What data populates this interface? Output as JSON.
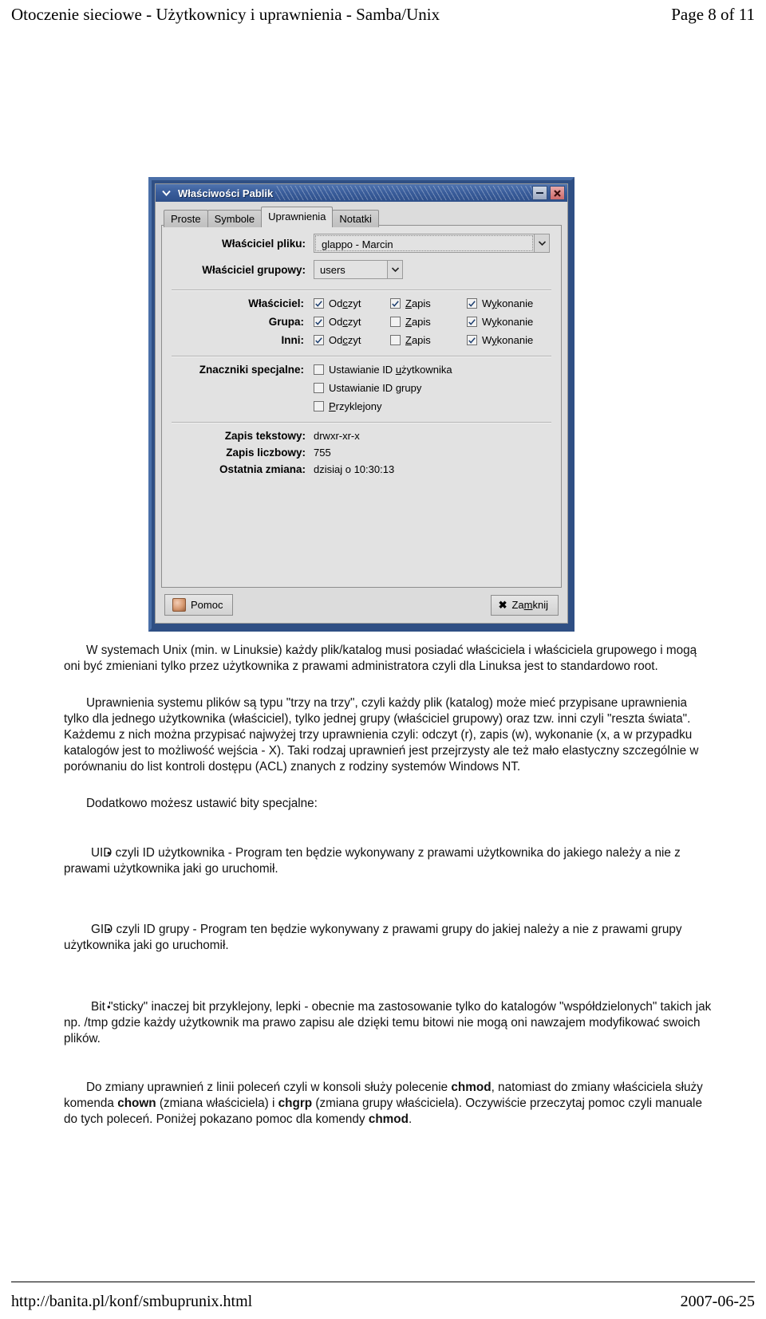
{
  "header": {
    "title": "Otoczenie sieciowe - Użytkownicy i uprawnienia - Samba/Unix",
    "page_label": "Page 8 of 11"
  },
  "dialog": {
    "window_title": "Właściwości Pablik",
    "menu_icon": "window-menu-icon",
    "minimize_label": "–",
    "close_label": "✖",
    "tabs": [
      {
        "label": "Proste",
        "active": false
      },
      {
        "label": "Symbole",
        "active": false
      },
      {
        "label": "Uprawnienia",
        "active": true
      },
      {
        "label": "Notatki",
        "active": false
      }
    ],
    "owner": {
      "label": "Właściciel pliku:",
      "value": "glappo - Marcin"
    },
    "group_owner": {
      "label": "Właściciel grupowy:",
      "value": "users"
    },
    "permissions": {
      "columns": [
        "Odczyt",
        "Zapis",
        "Wykonanie"
      ],
      "rows": [
        {
          "label": "Właściciel:",
          "read": true,
          "write": true,
          "exec": true
        },
        {
          "label": "Grupa:",
          "read": true,
          "write": false,
          "exec": true
        },
        {
          "label": "Inni:",
          "read": true,
          "write": false,
          "exec": true
        }
      ]
    },
    "special": {
      "label": "Znaczniki specjalne:",
      "items": [
        {
          "label_pre": "Ustawianie ID ",
          "label_acc": "u",
          "label_post": "żytkownika",
          "checked": false
        },
        {
          "label_pre": "Ustawianie ID ",
          "label_acc": "g",
          "label_post": "rupy",
          "checked": false
        },
        {
          "label_pre": "",
          "label_acc": "P",
          "label_post": "rzyklejony",
          "checked": false
        }
      ]
    },
    "info": [
      {
        "label": "Zapis tekstowy:",
        "value": "drwxr-xr-x"
      },
      {
        "label": "Zapis liczbowy:",
        "value": "755"
      },
      {
        "label": "Ostatnia zmiana:",
        "value": "dzisiaj o 10:30:13"
      }
    ],
    "buttons": {
      "help": "Pomoc",
      "close": "Zamknij"
    }
  },
  "body": {
    "p1": "W systemach Unix (min. w Linuksie) każdy plik/katalog musi posiadać właściciela i właściciela grupowego i mogą oni być zmieniani tylko przez użytkownika z prawami administratora czyli dla Linuksa jest to standardowo root.",
    "p2": "Uprawnienia systemu plików są typu \"trzy na trzy\", czyli każdy plik (katalog) może mieć przypisane uprawnienia tylko dla jednego użytkownika (właściciel), tylko jednej grupy (właściciel grupowy) oraz tzw. inni czyli \"reszta świata\". Każdemu z nich można przypisać najwyżej trzy uprawnienia czyli: odczyt (r), zapis (w), wykonanie (x, a w przypadku katalogów jest to możliwość wejścia - X). Taki rodzaj uprawnień jest przejrzysty ale też mało elastyczny szczególnie w porównaniu do list kontroli dostępu (ACL) znanych z rodziny systemów Windows NT.",
    "p3": "Dodatkowo możesz ustawić bity specjalne:",
    "bullet1": "UID czyli ID użytkownika -  Program ten będzie wykonywany z prawami użytkownika do jakiego należy a nie z prawami użytkownika jaki go uruchomił.",
    "bullet2": "GID czyli ID grupy - Program ten będzie wykonywany z prawami grupy do jakiej należy a nie z prawami grupy użytkownika jaki go uruchomił.",
    "bullet3": "Bit \"sticky\" inaczej bit przyklejony, lepki - obecnie ma zastosowanie tylko do katalogów \"współdzielonych\" takich jak np. /tmp gdzie każdy użytkownik ma prawo zapisu ale dzięki temu bitowi nie mogą oni nawzajem modyfikować swoich plików.",
    "p4_a": "Do zmiany uprawnień z linii poleceń czyli w konsoli służy polecenie ",
    "p4_cmd1": "chmod",
    "p4_b": ", natomiast do zmiany właściciela służy komenda ",
    "p4_cmd2": "chown",
    "p4_c": " (zmiana właściciela) i ",
    "p4_cmd3": "chgrp",
    "p4_d": " (zmiana grupy właściciela). Oczywiście przeczytaj pomoc czyli manuale do tych poleceń. Poniżej pokazano pomoc dla komendy ",
    "p4_cmd4": "chmod",
    "p4_e": "."
  },
  "footer": {
    "url": "http://banita.pl/konf/smbuprunix.html",
    "date": "2007-06-25"
  }
}
